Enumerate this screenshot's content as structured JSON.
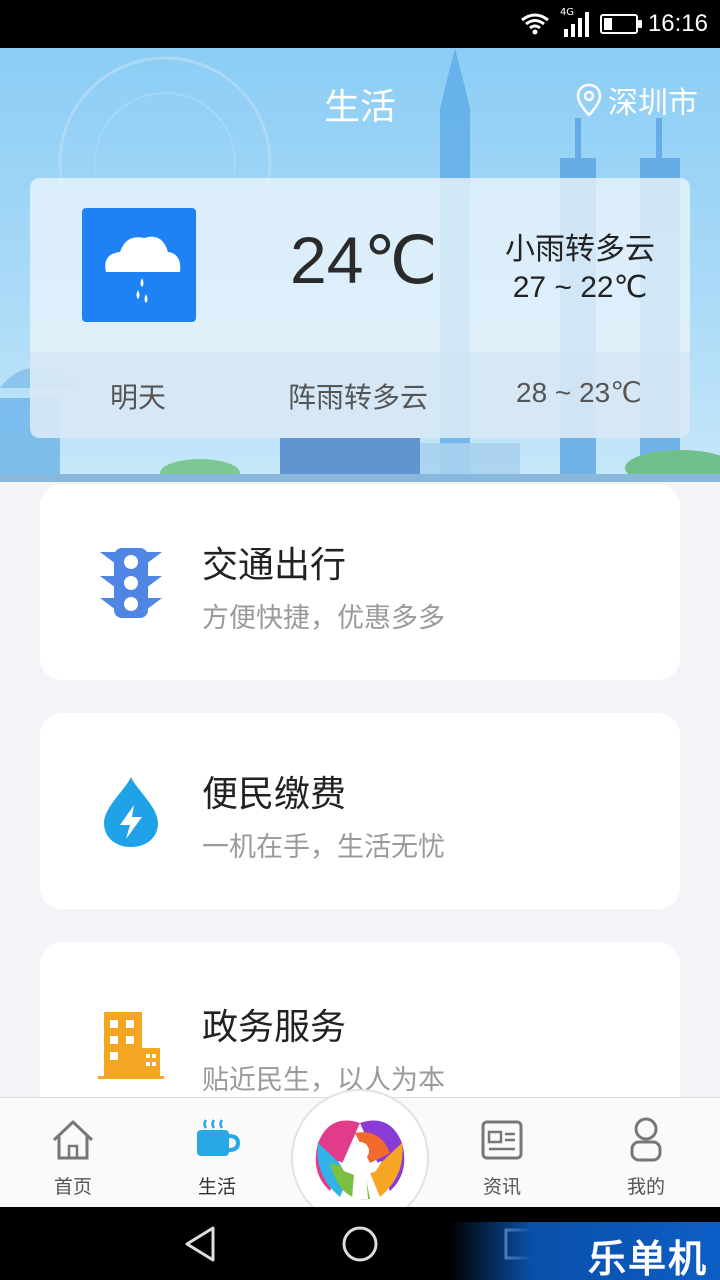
{
  "status_bar": {
    "time": "16:16",
    "network": "4G",
    "battery_level": 0.25
  },
  "header": {
    "title": "生活",
    "city": "深圳市"
  },
  "weather": {
    "icon": "rain-cloud-icon",
    "current_temp": "24℃",
    "today_condition": "小雨转多云",
    "today_range": "27 ~ 22℃",
    "tomorrow_label": "明天",
    "tomorrow_condition": "阵雨转多云",
    "tomorrow_range": "28 ~ 23℃"
  },
  "services": [
    {
      "title": "交通出行",
      "subtitle": "方便快捷，优惠多多",
      "icon": "traffic-light-icon"
    },
    {
      "title": "便民缴费",
      "subtitle": "一机在手，生活无忧",
      "icon": "water-drop-bolt-icon"
    },
    {
      "title": "政务服务",
      "subtitle": "贴近民生，以人为本",
      "icon": "building-icon"
    }
  ],
  "bottom_nav": {
    "items": [
      {
        "label": "首页",
        "icon": "home-icon"
      },
      {
        "label": "生活",
        "icon": "coffee-cup-icon",
        "active": true
      },
      {
        "label": "资讯",
        "icon": "news-icon"
      },
      {
        "label": "我的",
        "icon": "user-icon"
      }
    ],
    "center_icon": "app-logo-icon"
  },
  "watermark": "乐单机",
  "colors": {
    "accent": "#1e82f5",
    "active_tab": "#29a8e8",
    "icon_blue": "#4f86e3",
    "icon_orange": "#f5a623"
  }
}
